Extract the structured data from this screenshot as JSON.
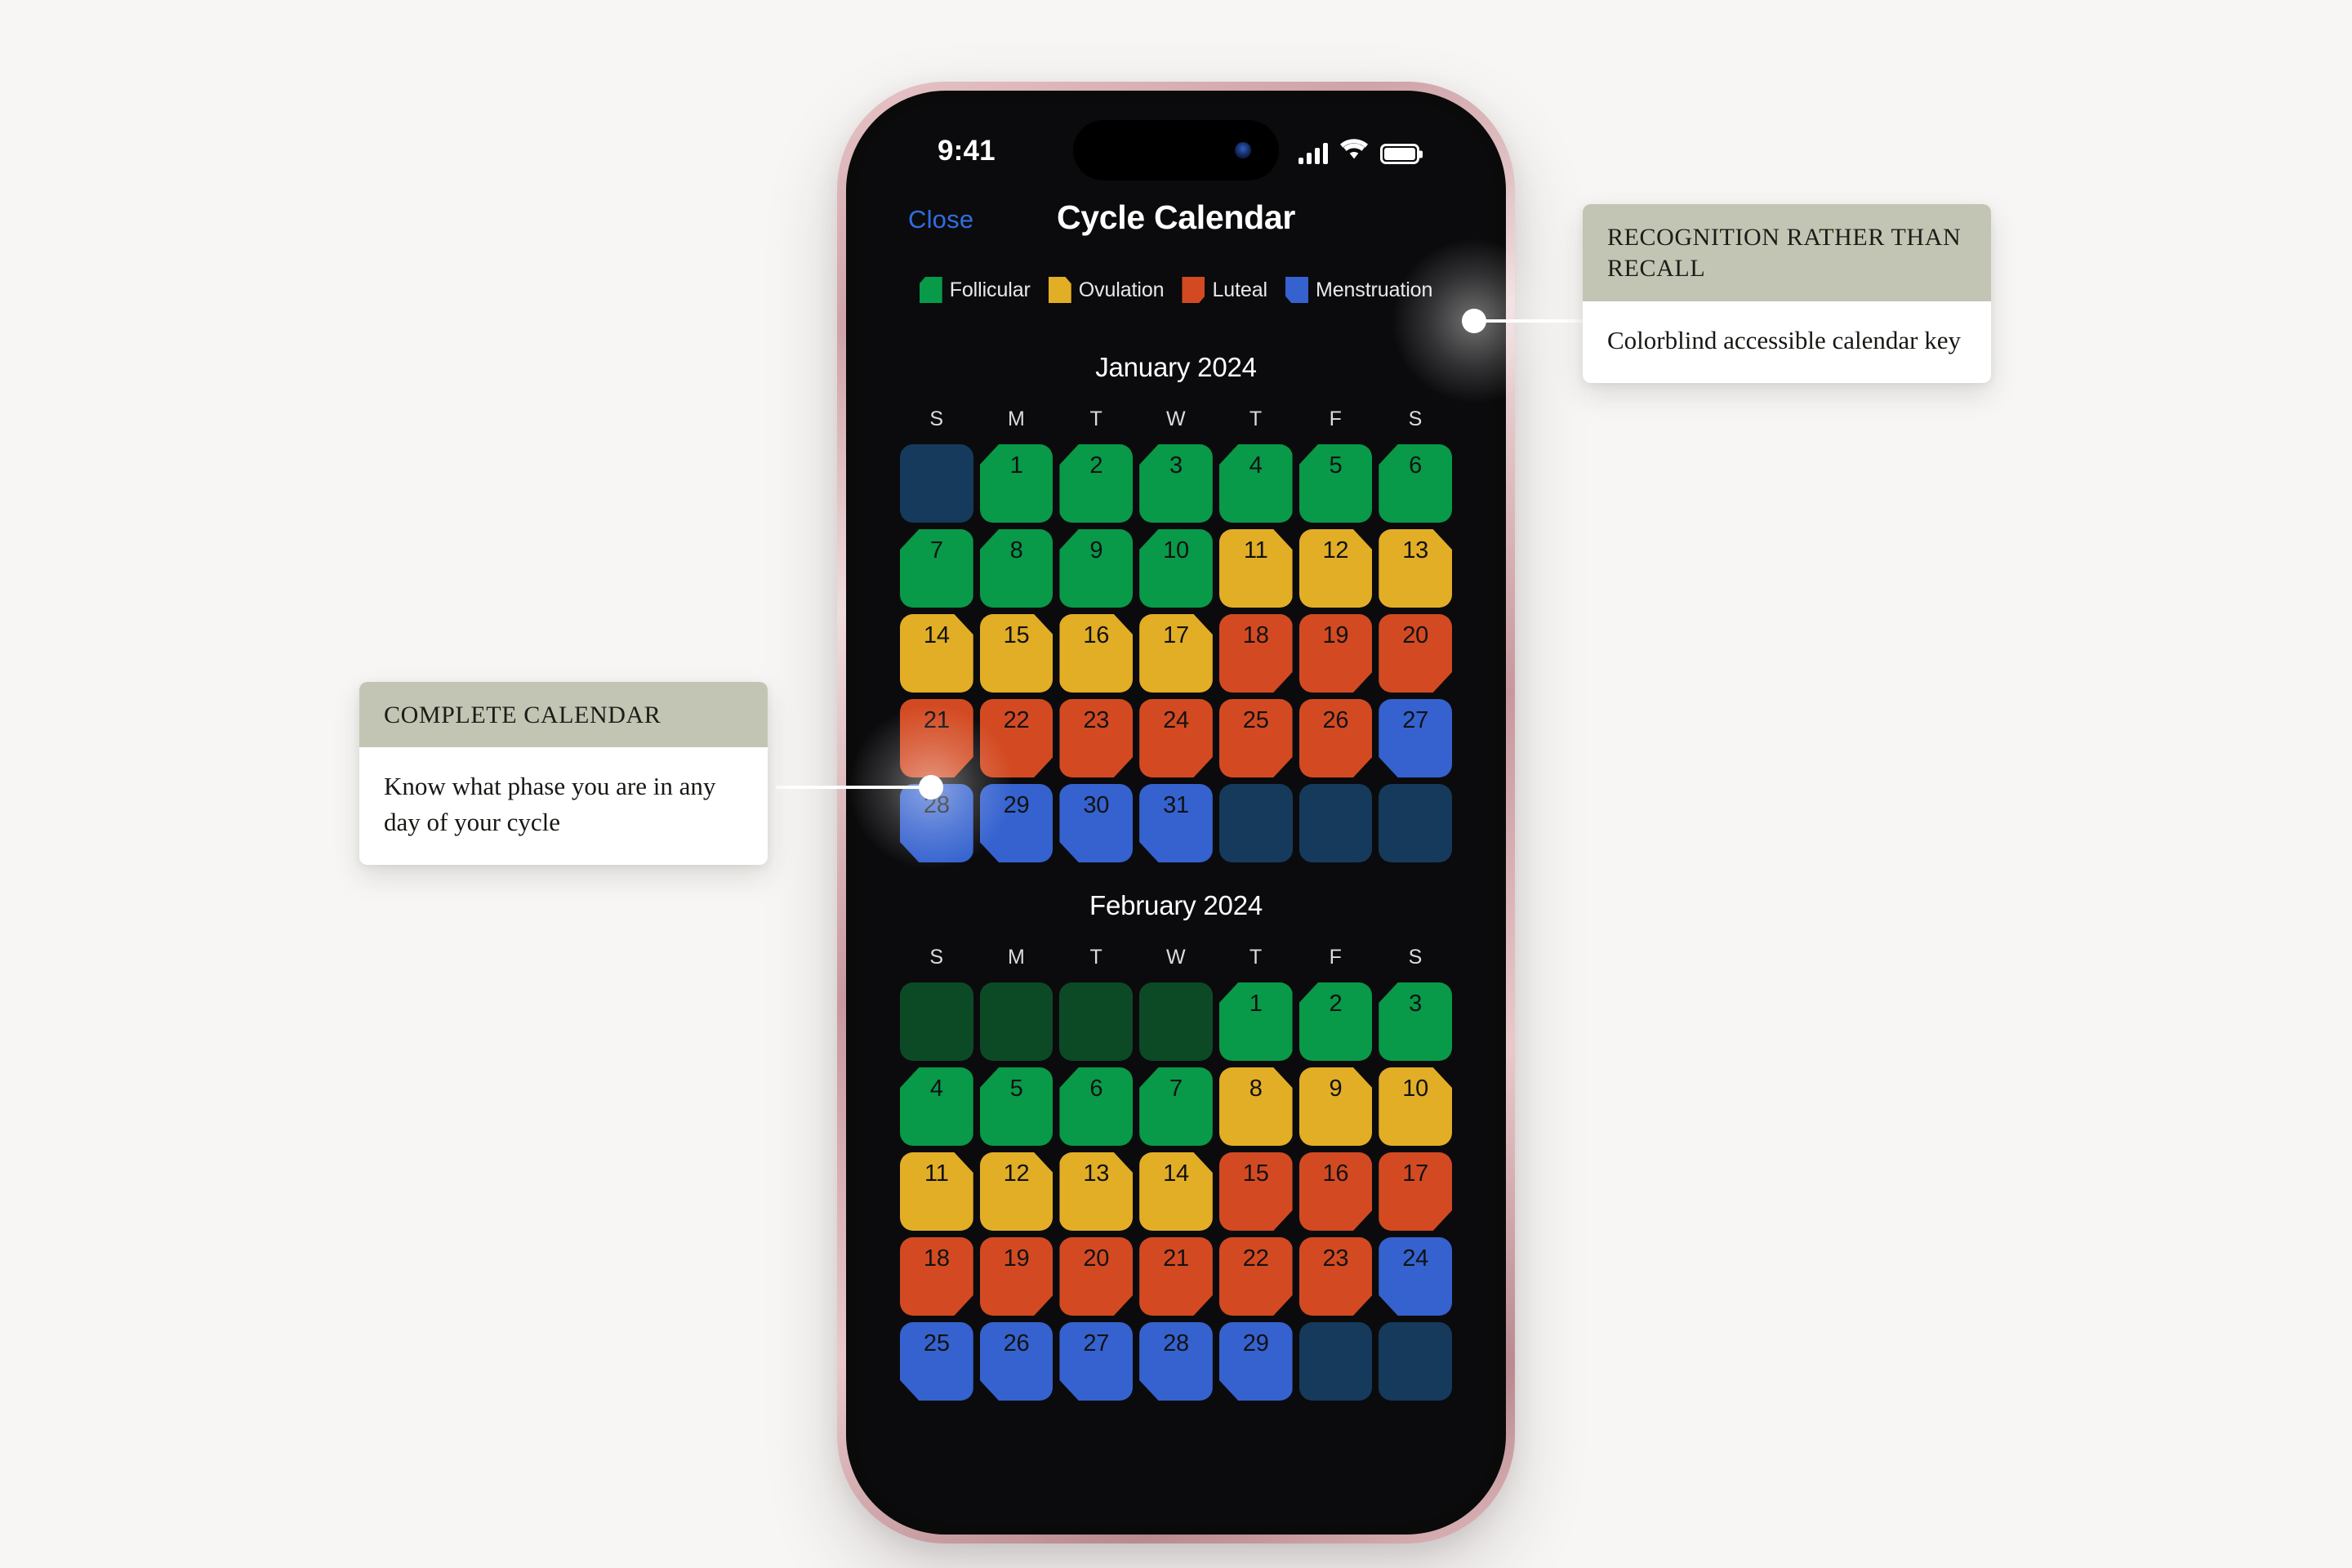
{
  "status_bar": {
    "time": "9:41",
    "signal_icon": "cellular-signal-icon",
    "wifi_icon": "wifi-icon",
    "battery_icon": "battery-icon"
  },
  "nav": {
    "close_label": "Close",
    "title": "Cycle Calendar"
  },
  "legend": {
    "items": [
      {
        "label": "Follicular",
        "color": "#089949",
        "shape": "cut-top-left"
      },
      {
        "label": "Ovulation",
        "color": "#e2ae26",
        "shape": "cut-top-right"
      },
      {
        "label": "Luteal",
        "color": "#d34a22",
        "shape": "cut-bottom-right"
      },
      {
        "label": "Menstruation",
        "color": "#3562cf",
        "shape": "cut-bottom-left"
      }
    ]
  },
  "weekdays": [
    "S",
    "M",
    "T",
    "W",
    "T",
    "F",
    "S"
  ],
  "months": [
    {
      "title": "January 2024",
      "days": [
        {
          "num": "",
          "phase": "empty-blue"
        },
        {
          "num": "1",
          "phase": "follicular"
        },
        {
          "num": "2",
          "phase": "follicular"
        },
        {
          "num": "3",
          "phase": "follicular"
        },
        {
          "num": "4",
          "phase": "follicular"
        },
        {
          "num": "5",
          "phase": "follicular"
        },
        {
          "num": "6",
          "phase": "follicular"
        },
        {
          "num": "7",
          "phase": "follicular"
        },
        {
          "num": "8",
          "phase": "follicular"
        },
        {
          "num": "9",
          "phase": "follicular"
        },
        {
          "num": "10",
          "phase": "follicular"
        },
        {
          "num": "11",
          "phase": "ovulation"
        },
        {
          "num": "12",
          "phase": "ovulation"
        },
        {
          "num": "13",
          "phase": "ovulation"
        },
        {
          "num": "14",
          "phase": "ovulation"
        },
        {
          "num": "15",
          "phase": "ovulation"
        },
        {
          "num": "16",
          "phase": "ovulation"
        },
        {
          "num": "17",
          "phase": "ovulation"
        },
        {
          "num": "18",
          "phase": "luteal"
        },
        {
          "num": "19",
          "phase": "luteal"
        },
        {
          "num": "20",
          "phase": "luteal"
        },
        {
          "num": "21",
          "phase": "luteal"
        },
        {
          "num": "22",
          "phase": "luteal"
        },
        {
          "num": "23",
          "phase": "luteal"
        },
        {
          "num": "24",
          "phase": "luteal"
        },
        {
          "num": "25",
          "phase": "luteal"
        },
        {
          "num": "26",
          "phase": "luteal"
        },
        {
          "num": "27",
          "phase": "menstruation"
        },
        {
          "num": "28",
          "phase": "menstruation"
        },
        {
          "num": "29",
          "phase": "menstruation"
        },
        {
          "num": "30",
          "phase": "menstruation"
        },
        {
          "num": "31",
          "phase": "menstruation"
        },
        {
          "num": "",
          "phase": "empty-blue"
        },
        {
          "num": "",
          "phase": "empty-blue"
        },
        {
          "num": "",
          "phase": "empty-blue"
        }
      ]
    },
    {
      "title": "February 2024",
      "days": [
        {
          "num": "",
          "phase": "empty-green"
        },
        {
          "num": "",
          "phase": "empty-green"
        },
        {
          "num": "",
          "phase": "empty-green"
        },
        {
          "num": "",
          "phase": "empty-green"
        },
        {
          "num": "1",
          "phase": "follicular"
        },
        {
          "num": "2",
          "phase": "follicular"
        },
        {
          "num": "3",
          "phase": "follicular"
        },
        {
          "num": "4",
          "phase": "follicular"
        },
        {
          "num": "5",
          "phase": "follicular"
        },
        {
          "num": "6",
          "phase": "follicular"
        },
        {
          "num": "7",
          "phase": "follicular"
        },
        {
          "num": "8",
          "phase": "ovulation"
        },
        {
          "num": "9",
          "phase": "ovulation"
        },
        {
          "num": "10",
          "phase": "ovulation"
        },
        {
          "num": "11",
          "phase": "ovulation"
        },
        {
          "num": "12",
          "phase": "ovulation"
        },
        {
          "num": "13",
          "phase": "ovulation"
        },
        {
          "num": "14",
          "phase": "ovulation"
        },
        {
          "num": "15",
          "phase": "luteal"
        },
        {
          "num": "16",
          "phase": "luteal"
        },
        {
          "num": "17",
          "phase": "luteal"
        },
        {
          "num": "18",
          "phase": "luteal"
        },
        {
          "num": "19",
          "phase": "luteal"
        },
        {
          "num": "20",
          "phase": "luteal"
        },
        {
          "num": "21",
          "phase": "luteal"
        },
        {
          "num": "22",
          "phase": "luteal"
        },
        {
          "num": "23",
          "phase": "luteal"
        },
        {
          "num": "24",
          "phase": "menstruation"
        },
        {
          "num": "25",
          "phase": "menstruation"
        },
        {
          "num": "26",
          "phase": "menstruation"
        },
        {
          "num": "27",
          "phase": "menstruation"
        },
        {
          "num": "28",
          "phase": "menstruation"
        },
        {
          "num": "29",
          "phase": "menstruation"
        },
        {
          "num": "",
          "phase": "empty-blue"
        },
        {
          "num": "",
          "phase": "empty-blue"
        }
      ]
    }
  ],
  "callouts": [
    {
      "id": "complete-calendar",
      "heading": "COMPLETE CALENDAR",
      "body": "Know what phase you are in any day of your cycle"
    },
    {
      "id": "recognition-rather-than-recall",
      "heading": "RECOGNITION RATHER THAN RECALL",
      "body": "Colorblind accessible calendar key"
    }
  ],
  "theme": {
    "page_background": "#f7f6f4",
    "callout_header_bg": "#c3c5b4",
    "screen_background": "#0b0b0d",
    "accent_link": "#2f6ee0"
  }
}
